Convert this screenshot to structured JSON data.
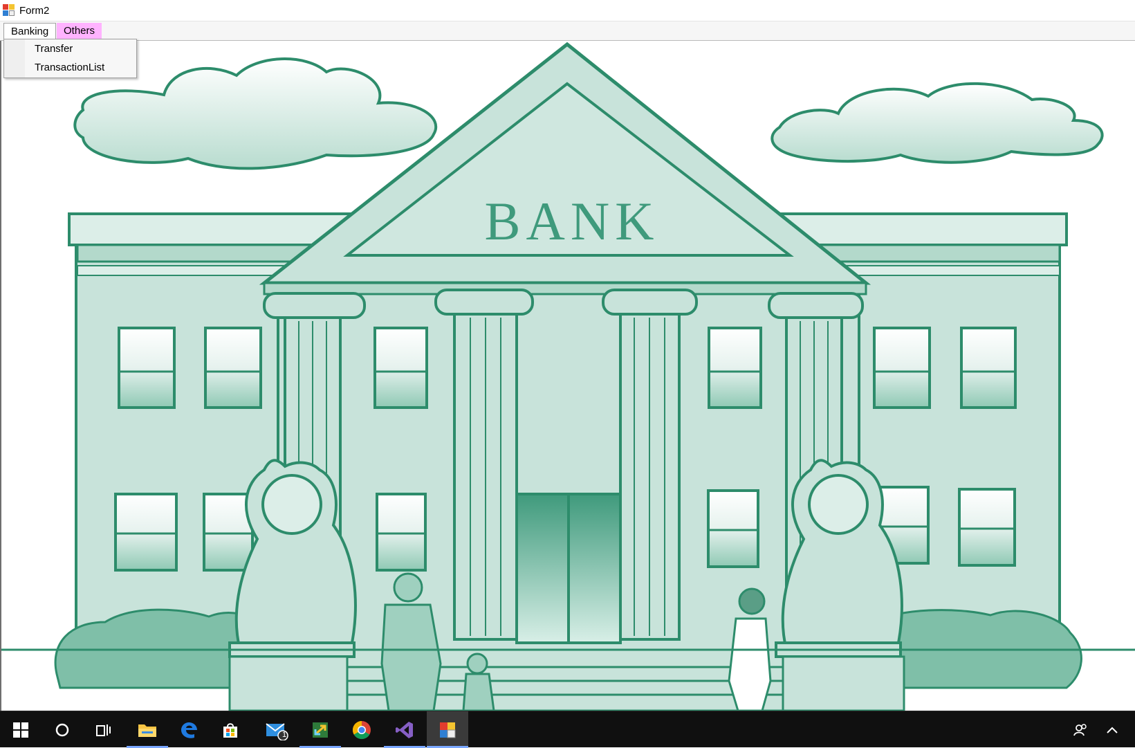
{
  "window": {
    "title": "Form2"
  },
  "menu": {
    "items": [
      {
        "label": "Banking"
      },
      {
        "label": "Others"
      }
    ],
    "banking_dropdown": [
      {
        "label": "Transfer"
      },
      {
        "label": "TransactionList"
      }
    ]
  },
  "illustration": {
    "sign_text": "BANK"
  },
  "taskbar": {
    "icons": [
      "windows-start-icon",
      "cortana-search-icon",
      "task-view-icon",
      "file-explorer-icon",
      "edge-browser-icon",
      "store-icon",
      "mail-icon",
      "remote-tool-icon",
      "chrome-icon",
      "visual-studio-icon",
      "form-app-icon"
    ],
    "mail_badge": "1",
    "tray_icons": [
      "people-icon",
      "show-hidden-icons-icon"
    ]
  },
  "colors": {
    "menu_highlight": "#ffb3ff",
    "bank_fill": "#c8e3da",
    "bank_stroke": "#2d8c6b",
    "taskbar_bg": "#101010"
  }
}
